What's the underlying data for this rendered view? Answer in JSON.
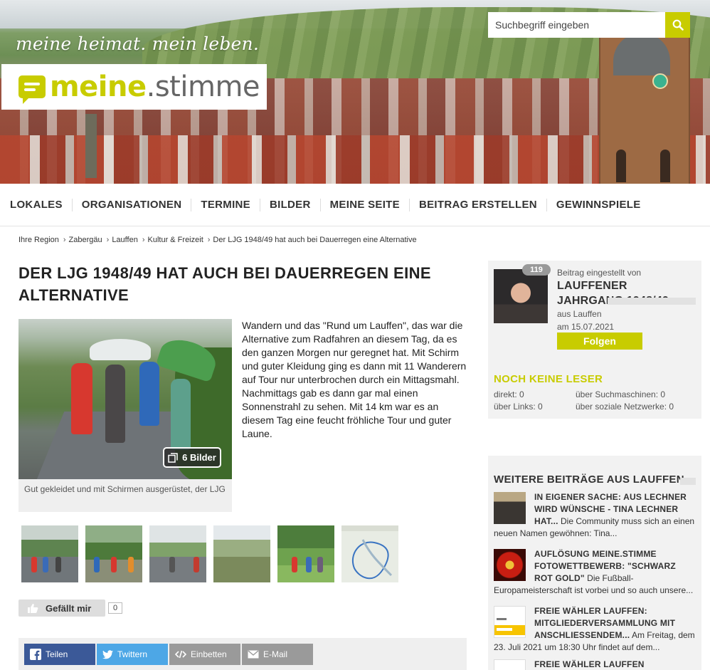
{
  "header": {
    "slogan": "meine heimat. mein leben.",
    "logo_bold": "meine",
    "logo_light": ".stimme",
    "search_placeholder": "Suchbegriff eingeben",
    "accent_color": "#c8cc00"
  },
  "nav": {
    "items": [
      "LOKALES",
      "ORGANISATIONEN",
      "TERMINE",
      "BILDER",
      "MEINE SEITE",
      "BEITRAG ERSTELLEN",
      "GEWINNSPIELE"
    ]
  },
  "breadcrumb": [
    "Ihre Region",
    "Zabergäu",
    "Lauffen",
    "Kultur & Freizeit",
    "Der LJG 1948/49 hat auch bei Dauerregen eine Alternative"
  ],
  "article": {
    "title": "DER LJG 1948/49 HAT AUCH BEI DAUERREGEN EINE ALTERNATIVE",
    "image_count_label": "6 Bilder",
    "image_caption": "Gut gekleidet und mit Schirmen ausgerüstet, der LJG",
    "body": "Wandern und das \"Rund um Lauffen\", das war die Alternative zum Radfahren an diesem Tag, da es den ganzen Morgen nur geregnet hat. Mit Schirm und guter Kleidung ging es dann mit 11 Wanderern auf Tour nur unterbrochen durch ein Mittagsmahl. Nachmittags gab es dann gar mal einen Sonnenstrahl zu sehen. Mit 14 km war es an diesem Tag eine feucht fröhliche Tour und guter Laune.",
    "thumbnail_count": 6,
    "like_label": "Gefällt mir",
    "like_count": "0"
  },
  "share": {
    "facebook": "Teilen",
    "twitter": "Twittern",
    "embed": "Einbetten",
    "email": "E-Mail"
  },
  "author": {
    "badge": "119",
    "posted_by": "Beitrag eingestellt von",
    "name": "LAUFFENER JAHRGANG 1948/49",
    "location": "aus Lauffen",
    "date": "am 15.07.2021",
    "follow": "Folgen",
    "readers_title": "NOCH KEINE LESER",
    "stats": {
      "direct": "direkt: 0",
      "search": "über Suchmaschinen: 0",
      "links": "über Links: 0",
      "social": "über soziale Netzwerke: 0"
    }
  },
  "more": {
    "title": "WEITERE BEITRÄGE AUS LAUFFEN",
    "entries": [
      {
        "title": "IN EIGENER SACHE: AUS LECHNER WIRD WÜNSCHE - TINA LECHNER HAT...",
        "teaser": " Die Community muss sich an einen neuen Namen gewöhnen: Tina..."
      },
      {
        "title": "AUFLÖSUNG MEINE.STIMME FOTOWETTBEWERB: \"SCHWARZ ROT GOLD\"",
        "teaser": " Die Fußball-Europameisterschaft ist vorbei und so auch unsere..."
      },
      {
        "title": "FREIE WÄHLER LAUFFEN: MITGLIEDERVERSAMMLUNG MIT ANSCHLIESSENDEM...",
        "teaser": " Am Freitag, dem 23. Juli 2021 um 18:30 Uhr findet auf dem..."
      },
      {
        "title": "FREIE WÄHLER LAUFFEN SOMMERFEST",
        "teaser": ""
      }
    ]
  }
}
